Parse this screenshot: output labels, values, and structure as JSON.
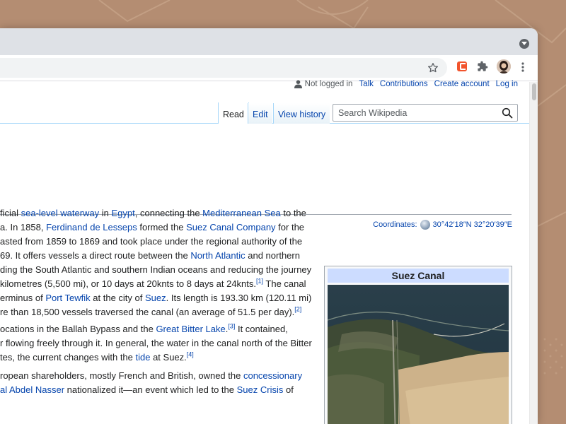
{
  "browser": {
    "colors": {
      "frame": "#dee1e6",
      "background": "#b48d72",
      "link": "#0645ad"
    }
  },
  "wiki": {
    "personal": {
      "user_label": "Not logged in",
      "talk": "Talk",
      "contributions": "Contributions",
      "create_account": "Create account",
      "login": "Log in"
    },
    "tabs": {
      "read": "Read",
      "edit": "Edit",
      "history": "View history"
    },
    "search_placeholder": "Search Wikipedia",
    "coordinates": {
      "label": "Coordinates:",
      "value": "30°42′18″N 32°20′39″E"
    },
    "article": {
      "p1": [
        [
          {
            "t": "ficial "
          },
          {
            "a": "sea-level waterway"
          },
          {
            "t": " in "
          },
          {
            "a": "Egypt"
          },
          {
            "t": ", connecting the "
          },
          {
            "a": "Mediterranean Sea"
          },
          {
            "t": " to the"
          }
        ],
        [
          {
            "t": "a. In 1858, "
          },
          {
            "a": "Ferdinand de Lesseps"
          },
          {
            "t": " formed the "
          },
          {
            "a": "Suez Canal Company"
          },
          {
            "t": " for the"
          }
        ],
        [
          {
            "t": "asted from 1859 to 1869 and took place under the regional authority of the"
          }
        ],
        [
          {
            "t": "69. It offers vessels a direct route between the "
          },
          {
            "a": "North Atlantic"
          },
          {
            "t": " and northern"
          }
        ],
        [
          {
            "t": "ding the South Atlantic and southern Indian oceans and reducing the journey"
          }
        ],
        [
          {
            "t": " kilometres (5,500 mi), or 10 days at 20knts to 8 days at 24knts."
          },
          {
            "s": "[1]"
          },
          {
            "t": " The canal"
          }
        ],
        [
          {
            "t": "erminus of "
          },
          {
            "a": "Port Tewfik"
          },
          {
            "t": " at the city of "
          },
          {
            "a": "Suez"
          },
          {
            "t": ". Its length is 193.30 km (120.11 mi)"
          }
        ],
        [
          {
            "t": "re than 18,500 vessels traversed the canal (an average of 51.5 per day)."
          },
          {
            "s": "[2]"
          }
        ]
      ],
      "p2": [
        [
          {
            "t": "ocations in the Ballah Bypass and the "
          },
          {
            "a": "Great Bitter Lake"
          },
          {
            "t": "."
          },
          {
            "s": "[3]"
          },
          {
            "t": " It contained,"
          }
        ],
        [
          {
            "t": "r flowing freely through it. In general, the water in the canal north of the Bitter"
          }
        ],
        [
          {
            "t": "tes, the current changes with the "
          },
          {
            "a": "tide"
          },
          {
            "t": " at Suez."
          },
          {
            "s": "[4]"
          }
        ]
      ],
      "p3": [
        [
          {
            "t": "ropean shareholders, mostly French and British, owned the "
          },
          {
            "a": "concessionary"
          }
        ],
        [
          {
            "a": "al Abdel Nasser"
          },
          {
            "t": " nationalized it—an event which led to the "
          },
          {
            "a": "Suez Crisis"
          },
          {
            "t": " of"
          }
        ]
      ]
    },
    "infobox": {
      "title": "Suez Canal"
    }
  }
}
